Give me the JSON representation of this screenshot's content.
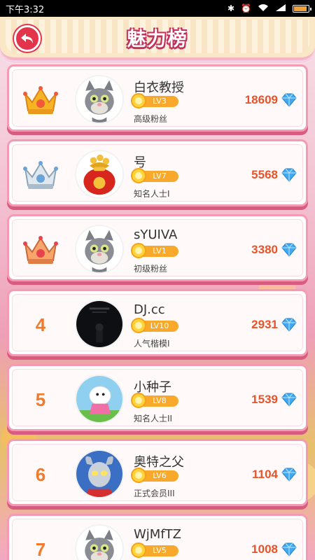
{
  "status": {
    "time": "下午3:32",
    "icons": [
      "bluetooth-icon",
      "alarm-icon",
      "wifi-icon",
      "signal-icon",
      "battery-icon"
    ]
  },
  "header": {
    "title": "魅力榜",
    "back_icon": "back-arrow-icon"
  },
  "colors": {
    "accent": "#e4344b",
    "points": "#e8532a",
    "level_badge": "#f8a92b",
    "rank": "#f07b2e",
    "card_border": "#f49ab3"
  },
  "rankings": [
    {
      "rank": "1",
      "rank_icon": "gold-crown-icon",
      "name": "白衣教授",
      "level": "LV3",
      "title": "高级粉丝",
      "points": "18609",
      "avatar": "tom-cat-avatar"
    },
    {
      "rank": "2",
      "rank_icon": "silver-crown-icon",
      "name": "号",
      "level": "LV7",
      "title": "知名人士I",
      "points": "5568",
      "avatar": "money-bag-avatar"
    },
    {
      "rank": "3",
      "rank_icon": "bronze-crown-icon",
      "name": "sYUIVA",
      "level": "LV1",
      "title": "初级粉丝",
      "points": "3380",
      "avatar": "tom-cat-avatar"
    },
    {
      "rank": "4",
      "rank_icon": "",
      "name": "DJ.cc",
      "level": "LV10",
      "title": "人气楷模I",
      "points": "2931",
      "avatar": "dark-poster-avatar"
    },
    {
      "rank": "5",
      "rank_icon": "",
      "name": "小种子",
      "level": "LV8",
      "title": "知名人士II",
      "points": "1539",
      "avatar": "cartoon-sheep-avatar"
    },
    {
      "rank": "6",
      "rank_icon": "",
      "name": "奥特之父",
      "level": "LV6",
      "title": "正式会员III",
      "points": "1104",
      "avatar": "ultraman-avatar"
    },
    {
      "rank": "7",
      "rank_icon": "",
      "name": "WjMfTZ",
      "level": "LV5",
      "title": "",
      "points": "1008",
      "avatar": "tom-cat-avatar"
    }
  ]
}
